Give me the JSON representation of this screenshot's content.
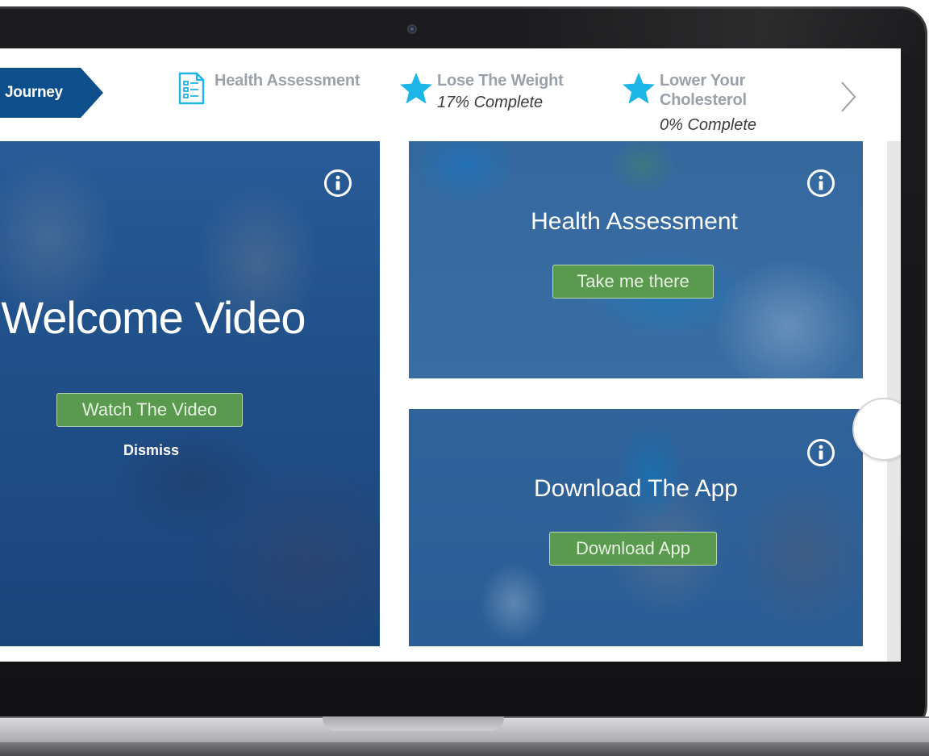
{
  "topnav": {
    "journey_label": "Journey",
    "items": [
      {
        "label": "Health Assessment",
        "progress": "",
        "icon": "checklist-document-icon"
      },
      {
        "label": "Lose The Weight",
        "progress": "17% Complete",
        "icon": "star-icon"
      },
      {
        "label": "Lower Your Cholesterol",
        "label_line1": "Lower Your",
        "label_line2": "Cholesterol",
        "progress": "0% Complete",
        "icon": "star-icon"
      }
    ],
    "next_icon": "chevron-right-icon"
  },
  "cards": {
    "welcome": {
      "title": "Welcome Video",
      "button": "Watch The Video",
      "dismiss": "Dismiss",
      "info_icon": "info-icon"
    },
    "health": {
      "title": "Health Assessment",
      "button": "Take me there",
      "info_icon": "info-icon"
    },
    "app": {
      "title": "Download The App",
      "button": "Download App",
      "info_icon": "info-icon"
    }
  },
  "carousel": {
    "next_icon": "chevron-right-icon"
  },
  "colors": {
    "brand_blue": "#0d4f8b",
    "accent_cyan": "#1eb6e6",
    "button_green": "#5a9a4f",
    "nav_gray": "#9aa1a8"
  }
}
